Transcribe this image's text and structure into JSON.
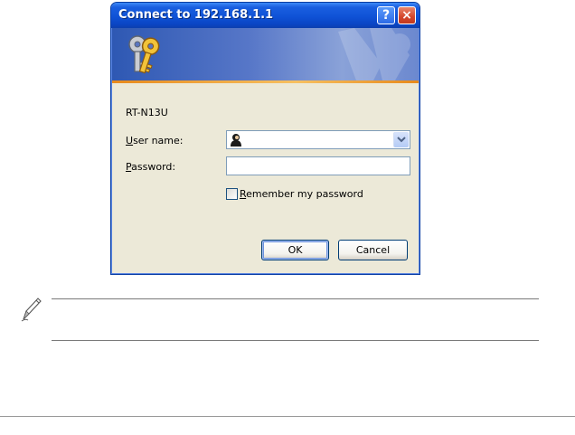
{
  "dialog": {
    "title": "Connect to 192.168.1.1",
    "help_glyph": "?",
    "close_glyph": "×",
    "banner_icon": "keys-icon",
    "device_name": "RT-N13U",
    "username": {
      "label_accel": "U",
      "label_rest": "ser name:",
      "value": "",
      "user_icon": "user-account-icon"
    },
    "password": {
      "label_accel": "P",
      "label_rest": "assword:",
      "value": ""
    },
    "remember": {
      "label_accel": "R",
      "label_rest": "emember my password",
      "checked": false
    },
    "ok_label": "OK",
    "cancel_label": "Cancel"
  },
  "note": {
    "icon": "pencil-note-icon",
    "text": ""
  },
  "colors": {
    "titlebar": "#0f52d6",
    "dialog_bg": "#ece9d8",
    "banner_accent": "#e78a1c"
  }
}
